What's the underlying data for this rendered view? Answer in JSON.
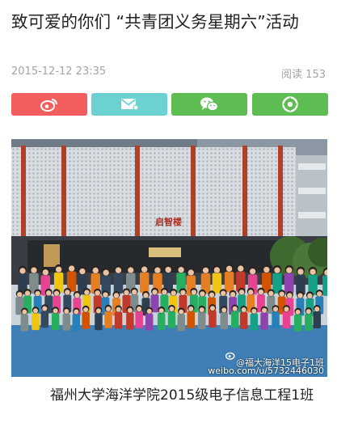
{
  "article": {
    "title": "致可爱的你们 “共青团义务星期六”活动",
    "date": "2015-12-12 23:35",
    "reads": "阅读 153",
    "caption": "福州大学海洋学院2015级电子信息工程1班"
  },
  "share": [
    {
      "name": "weibo",
      "color": "#f25e5e",
      "icon": "weibo-icon"
    },
    {
      "name": "message",
      "color": "#6cd1d3",
      "icon": "message-icon"
    },
    {
      "name": "wechat",
      "color": "#5dbc52",
      "icon": "wechat-icon"
    },
    {
      "name": "moments",
      "color": "#5dbc52",
      "icon": "moments-icon"
    }
  ],
  "photo": {
    "building_sign": "启智楼",
    "watermark_handle": "@福大海洋15电子1班",
    "watermark_url": "weibo.com/u/5732446030"
  }
}
